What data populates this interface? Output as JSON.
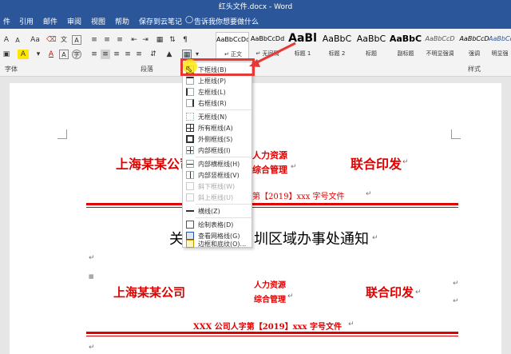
{
  "window": {
    "title": "红头文件.docx - Word"
  },
  "menubar": {
    "tabs": [
      "件",
      "引用",
      "邮件",
      "审阅",
      "视图",
      "帮助",
      "保存到云笔记"
    ],
    "tellme": "告诉我你想要做什么"
  },
  "ribbon": {
    "font_size_a": "A",
    "font_size_a_small": "A",
    "aa": "Aa",
    "font_color_a": "A",
    "highlight_a": "A",
    "border_dropdown": "▾",
    "groups": {
      "font": "字体",
      "paragraph": "段落",
      "styles": "样式"
    },
    "styles": [
      {
        "preview": "AaBbCcDd",
        "name": "↵ 正文"
      },
      {
        "preview": "AaBbCcDd",
        "name": "↵ 无间隔"
      },
      {
        "preview": "AaBl",
        "name": "标题 1"
      },
      {
        "preview": "AaBbC",
        "name": "标题 2"
      },
      {
        "preview": "AaBbC",
        "name": "标题"
      },
      {
        "preview": "AaBbC",
        "name": "副标题"
      },
      {
        "preview": "AaBbCcD",
        "name": "不明显强调"
      },
      {
        "preview": "AaBbCcD",
        "name": "强调"
      },
      {
        "preview": "AaBbCcD",
        "name": "明显强"
      }
    ]
  },
  "border_menu": {
    "items": [
      {
        "label": "下框线(B)",
        "enabled": true
      },
      {
        "label": "上框线(P)",
        "enabled": true
      },
      {
        "label": "左框线(L)",
        "enabled": true
      },
      {
        "label": "右框线(R)",
        "enabled": true
      },
      {
        "label": "无框线(N)",
        "enabled": true
      },
      {
        "label": "所有框线(A)",
        "enabled": true
      },
      {
        "label": "外侧框线(S)",
        "enabled": true
      },
      {
        "label": "内部框线(I)",
        "enabled": true
      },
      {
        "label": "内部横框线(H)",
        "enabled": true
      },
      {
        "label": "内部竖框线(V)",
        "enabled": true
      },
      {
        "label": "斜下框线(W)",
        "enabled": false
      },
      {
        "label": "斜上框线(U)",
        "enabled": false
      },
      {
        "label": "横线(Z)",
        "enabled": true
      },
      {
        "label": "绘制表格(D)",
        "enabled": true
      },
      {
        "label": "查看网格线(G)",
        "enabled": true
      },
      {
        "label": "边框和底纹(O)...",
        "enabled": true
      }
    ]
  },
  "document": {
    "header1": {
      "left": "上海某某公司",
      "mid_top": "人力资源",
      "mid_bottom": "综合管理",
      "right": "联合印发"
    },
    "docnum1": "第【2019】xxx 字号文件",
    "title_left": "关",
    "title_right": "圳区域办事处通知",
    "header2": {
      "left": "上海某某公司",
      "mid_top": "人力资源",
      "mid_bottom": "综合管理",
      "right": "联合印发"
    },
    "docnum2": "XXX 公司人字第【2019】xxx 字号文件",
    "para_mark": "↵"
  },
  "colors": {
    "title_bar": "#2b579a",
    "red_text": "#e00000",
    "highlight_box": "#e53935",
    "cursor_yellow": "#ffe600"
  }
}
